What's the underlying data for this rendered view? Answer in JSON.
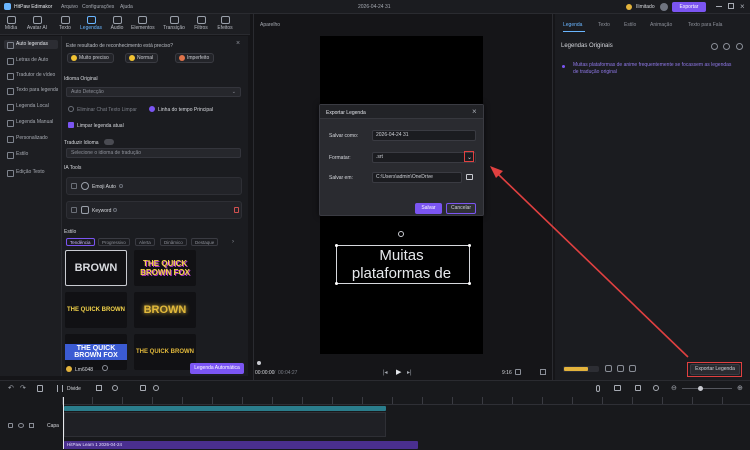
{
  "app": {
    "logo_text": "HitPaw Edimakor",
    "menu": [
      "Arquivo",
      "Configurações",
      "Ajuda"
    ],
    "project_title": "2026-04-24 31",
    "credits": "Ilimitado",
    "export_label": "Exportar"
  },
  "toolbar": {
    "items": [
      "Mídia",
      "Avatar AI",
      "Texto",
      "Legendas",
      "Áudio",
      "Elementos",
      "Transição",
      "Filtros",
      "Efeitos"
    ]
  },
  "leftnav": {
    "items": [
      "Auto legendas",
      "Letras de Auto",
      "Tradutor de vídeo",
      "Texto para legenda",
      "Legenda Local",
      "Legenda Manual",
      "Personalizado",
      "Estilo",
      "Edição Texto"
    ]
  },
  "panel": {
    "question": "Este resultado de reconhecimento está preciso?",
    "feedback": [
      "Muito preciso",
      "Normal",
      "Imperfeito"
    ],
    "idioma_label": "Idioma Original",
    "idioma_value": "Auto Detecção",
    "option_a": "Eliminar Chat Texto Limpar",
    "option_b": "Linha do tempo Principal",
    "clear_label": "Limpar legenda atual",
    "translate_label": "Traduzir Idioma",
    "translate_value": "Selecione o idioma de tradução",
    "ai_tools_label": "IA Tools",
    "emoji_label": "Emoji Auto",
    "keyword_label": "Keyword",
    "estilo_label": "Estilo",
    "style_tabs": [
      "Tendência",
      "Progressivo",
      "Alerta",
      "Dinâmico",
      "Destaque"
    ],
    "tiles": [
      "BROWN",
      "THE QUICK BROWN FOX",
      "THE QUICK BROWN",
      "BROWN",
      "THE QUICK BROWN FOX",
      "THE QUICK BROWN"
    ],
    "credits_value": "Lm6048",
    "generate_label": "Legenda Automática"
  },
  "preview": {
    "label": "Aparelho",
    "caption_line1": "Muitas",
    "caption_line2": "plataformas de",
    "time_current": "00:00:00",
    "time_total": "00:04:27",
    "ratio": "9:16"
  },
  "dialog": {
    "title": "Exportar Legenda",
    "save_as_label": "Salvar como:",
    "save_as_value": "2026-04-24 31",
    "format_label": "Formatar:",
    "format_value": ".srt",
    "save_in_label": "Salvar em:",
    "save_in_value": "C:\\Users\\admin\\OneDrive",
    "save_button": "Salvar",
    "cancel_button": "Cancelar"
  },
  "right": {
    "tabs": [
      "Legenda",
      "Texto",
      "Estilo",
      "Animação",
      "Texto para Fala"
    ],
    "section_title": "Legendas Originais",
    "subtitle_text": "Muitas plataformas de anime frequentemente se focassem as legendas de tradução original",
    "export_button": "Exportar Legenda"
  },
  "timeline": {
    "divide_label": "Divide",
    "track_label": "Capa",
    "clip_label": "HitPaw Learn 1 2026-04-24"
  },
  "colors": {
    "accent": "#7b55f2",
    "link": "#6ab6ff",
    "annotation": "#e04040"
  }
}
